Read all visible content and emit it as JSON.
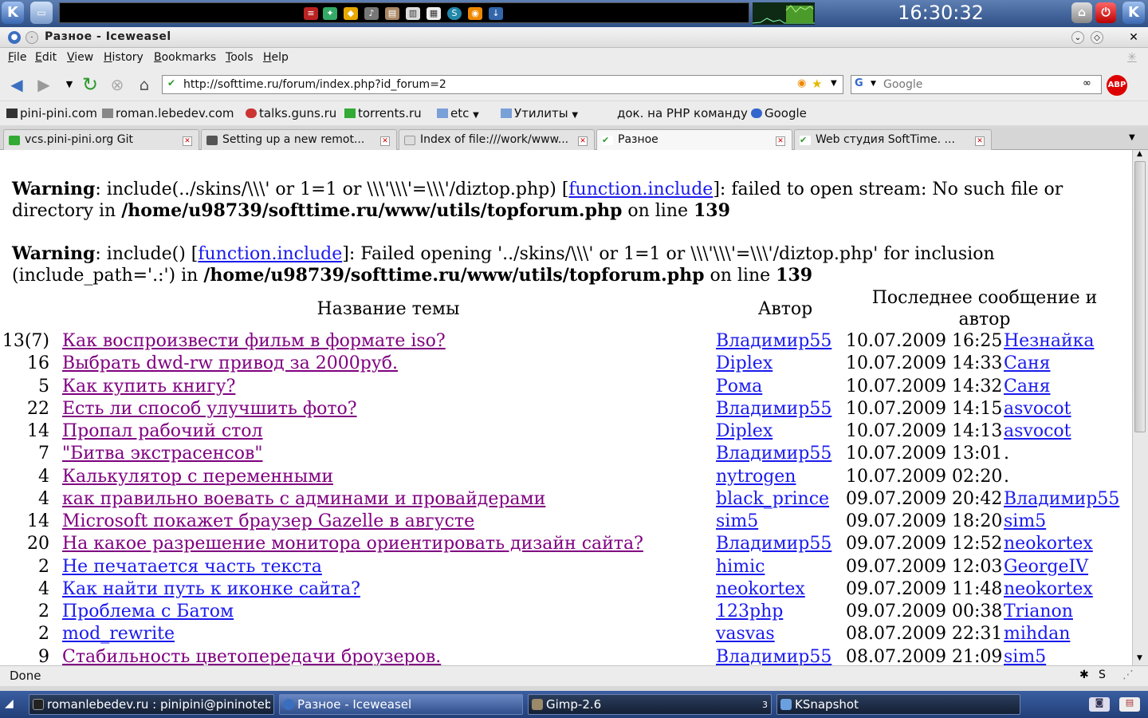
{
  "panel": {
    "clock": "16:30:32"
  },
  "window": {
    "title": "Разное - Iceweasel"
  },
  "menubar": {
    "items": [
      "File",
      "Edit",
      "View",
      "History",
      "Bookmarks",
      "Tools",
      "Help"
    ]
  },
  "navbar": {
    "url": "http://softtime.ru/forum/index.php?id_forum=2",
    "search_placeholder": "Google"
  },
  "bookmarks": {
    "items": [
      "pini-pini.com",
      "roman.lebedev.com",
      "talks.guns.ru",
      "torrents.ru",
      "etc",
      "Утилиты",
      "док. на PHP команду",
      "Google"
    ]
  },
  "tabs": [
    {
      "label": "vcs.pini-pini.org Git"
    },
    {
      "label": "Setting up a new remot..."
    },
    {
      "label": "Index of file:///work/www..."
    },
    {
      "label": "Разное",
      "active": true
    },
    {
      "label": "Web студия SoftTime. ..."
    }
  ],
  "content": {
    "warning1": {
      "label": "Warning",
      "text1": ": include(../skins/\\\\\\' or 1=1 or \\\\\\'\\\\\\'=\\\\\\'/diztop.php) [",
      "link": "function.include",
      "text2": "]: failed to open stream: No such file or directory in ",
      "path": "/home/u98739/softtime.ru/www/utils/topforum.php",
      "text3": " on line ",
      "line": "139"
    },
    "warning2": {
      "label": "Warning",
      "text1": ": include() [",
      "link": "function.include",
      "text2": "]: Failed opening '../skins/\\\\\\' or 1=1 or \\\\\\'\\\\\\'=\\\\\\'/diztop.php' for inclusion (include_path='.:') in ",
      "path": "/home/u98739/softtime.ru/www/utils/topforum.php",
      "text3": " on line ",
      "line": "139"
    },
    "headers": {
      "topic": "Название темы",
      "author": "Автор",
      "last": "Последнее сообщение и автор"
    },
    "rows": [
      {
        "count": "13(7)",
        "topic": "Как воспроизвести фильм в формате iso?",
        "visited": true,
        "author": "Владимир55",
        "date": "10.07.2009 16:25",
        "last": "Незнайка"
      },
      {
        "count": "16",
        "topic": "Выбрать dwd-rw привод за 2000руб.",
        "visited": true,
        "author": "Diplex",
        "date": "10.07.2009 14:33",
        "last": "Саня"
      },
      {
        "count": "5",
        "topic": "Как купить книгу?",
        "visited": true,
        "author": "Рома",
        "date": "10.07.2009 14:32",
        "last": "Саня"
      },
      {
        "count": "22",
        "topic": "Есть ли способ улучшить фото?",
        "visited": true,
        "author": "Владимир55",
        "date": "10.07.2009 14:15",
        "last": "asvocot"
      },
      {
        "count": "14",
        "topic": "Пропал рабочий стол",
        "visited": true,
        "author": "Diplex",
        "date": "10.07.2009 14:13",
        "last": "asvocot"
      },
      {
        "count": "7",
        "topic": "\"Битва экстрасенсов\"",
        "visited": true,
        "author": "Владимир55",
        "date": "10.07.2009 13:01",
        "last": "."
      },
      {
        "count": "4",
        "topic": "Калькулятор с переменными",
        "visited": true,
        "author": "nytrogen",
        "date": "10.07.2009 02:20",
        "last": "."
      },
      {
        "count": "4",
        "topic": "как правильно воевать с админами и провайдерами",
        "visited": true,
        "author": "black_prince",
        "date": "09.07.2009 20:42",
        "last": "Владимир55"
      },
      {
        "count": "14",
        "topic": "Microsoft покажет браузер Gazelle в августе",
        "visited": true,
        "author": "sim5",
        "date": "09.07.2009 18:20",
        "last": "sim5"
      },
      {
        "count": "20",
        "topic": "На какое разрешение монитора ориентировать дизайн сайта?",
        "visited": true,
        "author": "Владимир55",
        "date": "09.07.2009 12:52",
        "last": "neokortex"
      },
      {
        "count": "2",
        "topic": "Не печатается часть текста",
        "visited": false,
        "author": "himic",
        "date": "09.07.2009 12:03",
        "last": "GeorgeIV"
      },
      {
        "count": "4",
        "topic": "Как найти путь к иконке сайта?",
        "visited": false,
        "author": "neokortex",
        "date": "09.07.2009 11:48",
        "last": "neokortex"
      },
      {
        "count": "2",
        "topic": "Проблема с Батом",
        "visited": false,
        "author": "123php",
        "date": "09.07.2009 00:38",
        "last": "Trianon"
      },
      {
        "count": "2",
        "topic": "mod_rewrite",
        "visited": false,
        "author": "vasvas",
        "date": "08.07.2009 22:31",
        "last": "mihdan"
      },
      {
        "count": "9",
        "topic": "Стабильность цветопередачи броузеров.",
        "visited": true,
        "author": "Владимир55",
        "date": "08.07.2009 21:09",
        "last": "sim5"
      }
    ]
  },
  "status": {
    "text": "Done"
  },
  "taskbar": {
    "tasks": [
      {
        "label": "romanlebedev.ru : pinipini@pininotebo"
      },
      {
        "label": "Разное - Iceweasel",
        "active": true
      },
      {
        "label": "Gimp-2.6"
      },
      {
        "label": "KSnapshot"
      }
    ],
    "gimp_count": "3"
  },
  "colors": {
    "visited_link": "#800080",
    "link": "#1a1aee",
    "panel": "#2f4f86"
  }
}
